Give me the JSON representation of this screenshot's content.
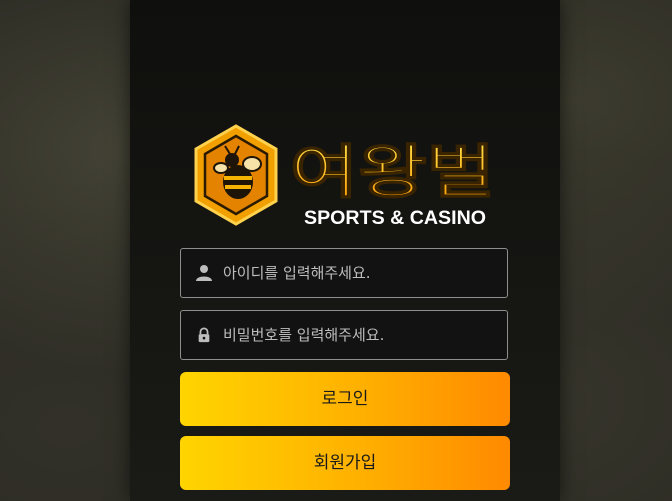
{
  "brand": {
    "name": "여왕벌",
    "tagline": "SPORTS & CASINO"
  },
  "login_form": {
    "id_field": {
      "placeholder": "아이디를 입력해주세요.",
      "icon": "user-icon"
    },
    "password_field": {
      "placeholder": "비밀번호를 입력해주세요.",
      "icon": "lock-icon"
    },
    "login_button": "로그인",
    "signup_button": "회원가입"
  },
  "colors": {
    "accent_start": "#ffd400",
    "accent_end": "#ff8a00",
    "panel_bg": "#141411",
    "field_border": "#8e8e8e"
  }
}
